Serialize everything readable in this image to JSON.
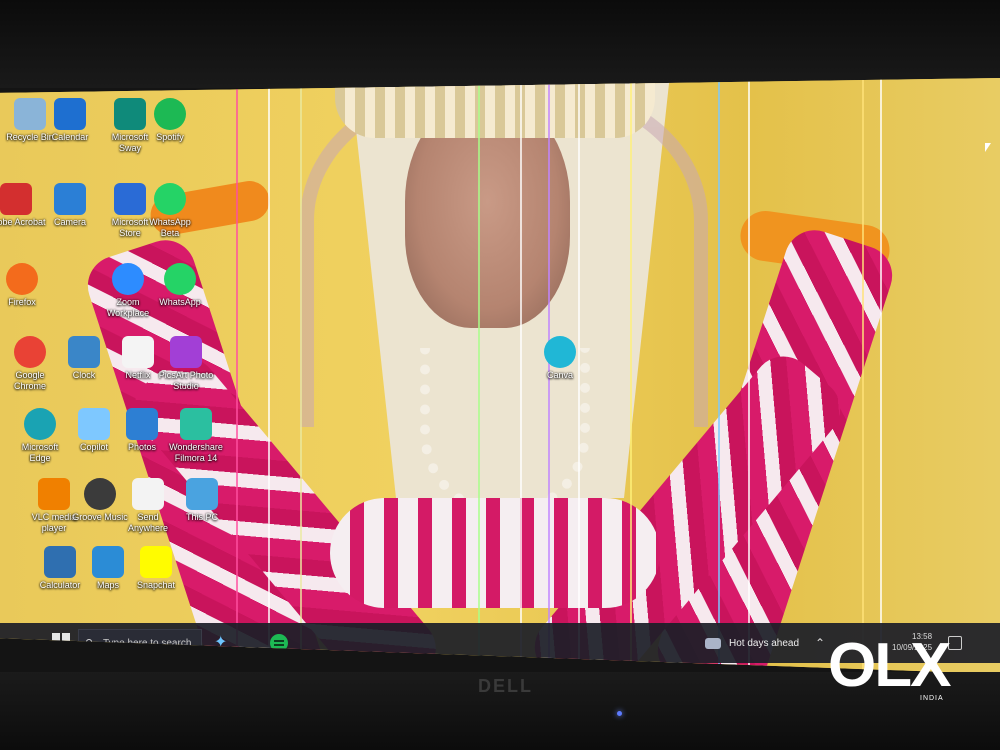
{
  "desktop": {
    "icons": [
      {
        "label": "Recycle Bin",
        "icon": "recycle-bin-icon",
        "color": "#8ab4d8"
      },
      {
        "label": "Calendar",
        "icon": "calendar-icon",
        "color": "#1e6fd0"
      },
      {
        "label": "Microsoft Sway",
        "icon": "sway-icon",
        "color": "#0f8a7a"
      },
      {
        "label": "Spotify",
        "icon": "spotify-icon",
        "color": "#1db954"
      },
      {
        "label": "Adobe Acrobat",
        "icon": "acrobat-icon",
        "color": "#d32f2f"
      },
      {
        "label": "Camera",
        "icon": "camera-icon",
        "color": "#2b7fd6"
      },
      {
        "label": "Microsoft Store",
        "icon": "store-icon",
        "color": "#2a6bd6"
      },
      {
        "label": "WhatsApp Beta",
        "icon": "whatsapp-beta-icon",
        "color": "#25d366"
      },
      {
        "label": "Firefox",
        "icon": "firefox-icon",
        "color": "#f36b1c"
      },
      {
        "label": "Zoom Workplace",
        "icon": "zoom-icon",
        "color": "#2d8cff"
      },
      {
        "label": "WhatsApp",
        "icon": "whatsapp-icon",
        "color": "#25d366"
      },
      {
        "label": "Google Chrome",
        "icon": "chrome-icon",
        "color": "#e94235"
      },
      {
        "label": "Clock",
        "icon": "clock-icon",
        "color": "#3a86c8"
      },
      {
        "label": "Netflix",
        "icon": "netflix-icon",
        "color": "#f4f4f4"
      },
      {
        "label": "PicsArt Photo Studio",
        "icon": "picsart-icon",
        "color": "#a23fd6"
      },
      {
        "label": "Canva",
        "icon": "canva-icon",
        "color": "#20b7d6"
      },
      {
        "label": "Microsoft Edge",
        "icon": "edge-icon",
        "color": "#1aa3b3"
      },
      {
        "label": "Copilot",
        "icon": "copilot-icon",
        "color": "#7ec8ff"
      },
      {
        "label": "Photos",
        "icon": "photos-icon",
        "color": "#2d7fd3"
      },
      {
        "label": "Wondershare Filmora 14",
        "icon": "filmora-icon",
        "color": "#2bbfa0"
      },
      {
        "label": "VLC media player",
        "icon": "vlc-icon",
        "color": "#f08000"
      },
      {
        "label": "Groove Music",
        "icon": "groove-icon",
        "color": "#3b3b3b"
      },
      {
        "label": "Send Anywhere",
        "icon": "send-anywhere-icon",
        "color": "#f3f3f3"
      },
      {
        "label": "This PC",
        "icon": "this-pc-icon",
        "color": "#4aa3e0"
      },
      {
        "label": "Calculator",
        "icon": "calculator-icon",
        "color": "#2f6fb0"
      },
      {
        "label": "Maps",
        "icon": "maps-icon",
        "color": "#2b8cd6"
      },
      {
        "label": "Snapchat",
        "icon": "snapchat-icon",
        "color": "#fffc00"
      }
    ]
  },
  "taskbar": {
    "search_placeholder": "Type here to search",
    "weather_text": "Hot days ahead",
    "clock_time": "13:58",
    "clock_date": "10/09/2025",
    "pinned": [
      {
        "name": "copilot",
        "icon": "copilot-icon"
      },
      {
        "name": "spotify",
        "icon": "spotify-icon"
      }
    ]
  },
  "monitor": {
    "brand": "DELL"
  },
  "watermark": {
    "text": "OLX",
    "region": "INDIA"
  },
  "colors": {
    "taskbar_bg": "#1c1e28",
    "wallpaper_yellow": "#e9c95a",
    "garland_pink": "#d81b6a"
  }
}
